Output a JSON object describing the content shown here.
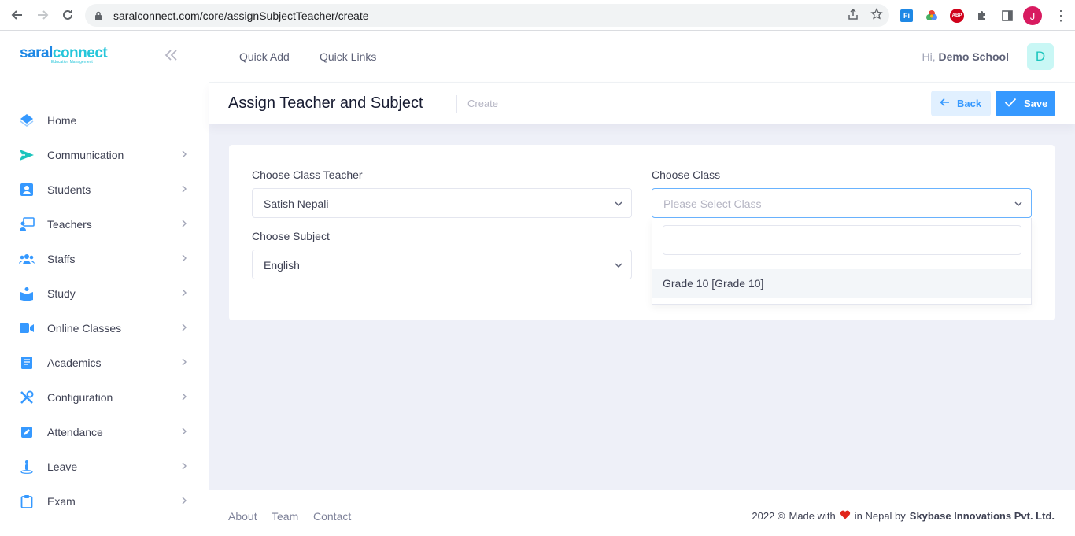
{
  "browser": {
    "url": "saralconnect.com/core/assignSubjectTeacher/create",
    "profile_initial": "J",
    "extensions": [
      "fi-extension-icon",
      "color-wheel-extension-icon",
      "abp-extension-icon",
      "puzzle-extensions-icon",
      "side-panel-icon"
    ],
    "abp_label": "ABP",
    "fi_label": "Fi"
  },
  "sidebar": {
    "logo": {
      "part1": "saral",
      "part2": "connect",
      "tagline": "Education Management"
    },
    "items": [
      {
        "label": "Home",
        "icon": "home-icon",
        "color": "#3699ff",
        "chevron": false
      },
      {
        "label": "Communication",
        "icon": "send-icon",
        "color": "#1bc5bd",
        "chevron": true
      },
      {
        "label": "Students",
        "icon": "student-icon",
        "color": "#3699ff",
        "chevron": true
      },
      {
        "label": "Teachers",
        "icon": "teacher-icon",
        "color": "#3699ff",
        "chevron": true
      },
      {
        "label": "Staffs",
        "icon": "users-icon",
        "color": "#3699ff",
        "chevron": true
      },
      {
        "label": "Study",
        "icon": "book-reader-icon",
        "color": "#3699ff",
        "chevron": true
      },
      {
        "label": "Online Classes",
        "icon": "video-icon",
        "color": "#3699ff",
        "chevron": true
      },
      {
        "label": "Academics",
        "icon": "notebook-icon",
        "color": "#3699ff",
        "chevron": true
      },
      {
        "label": "Configuration",
        "icon": "tools-icon",
        "color": "#3699ff",
        "chevron": true
      },
      {
        "label": "Attendance",
        "icon": "edit-icon",
        "color": "#3699ff",
        "chevron": true
      },
      {
        "label": "Leave",
        "icon": "person-location-icon",
        "color": "#3699ff",
        "chevron": true
      },
      {
        "label": "Exam",
        "icon": "clipboard-icon",
        "color": "#3699ff",
        "chevron": true
      }
    ]
  },
  "header": {
    "links": [
      "Quick Add",
      "Quick Links"
    ],
    "greeting": "Hi,",
    "user_name": "Demo School",
    "avatar_initial": "D"
  },
  "subheader": {
    "title": "Assign Teacher and Subject",
    "breadcrumb": "Create",
    "back_label": "Back",
    "save_label": "Save"
  },
  "form": {
    "teacher": {
      "label": "Choose Class Teacher",
      "value": "Satish Nepali"
    },
    "subject": {
      "label": "Choose Subject",
      "value": "English"
    },
    "class": {
      "label": "Choose Class",
      "placeholder": "Please Select Class",
      "search_value": "",
      "options": [
        "Grade 10 [Grade 10]"
      ]
    }
  },
  "footer": {
    "links": [
      "About",
      "Team",
      "Contact"
    ],
    "year": "2022 ©",
    "made_with": "Made with",
    "in_nepal": "in Nepal by",
    "company": "Skybase Innovations Pvt. Ltd."
  },
  "colors": {
    "primary": "#3699ff",
    "primary_light": "#e1f0ff",
    "accent": "#1bc5bd",
    "heart": "#f64e60"
  }
}
